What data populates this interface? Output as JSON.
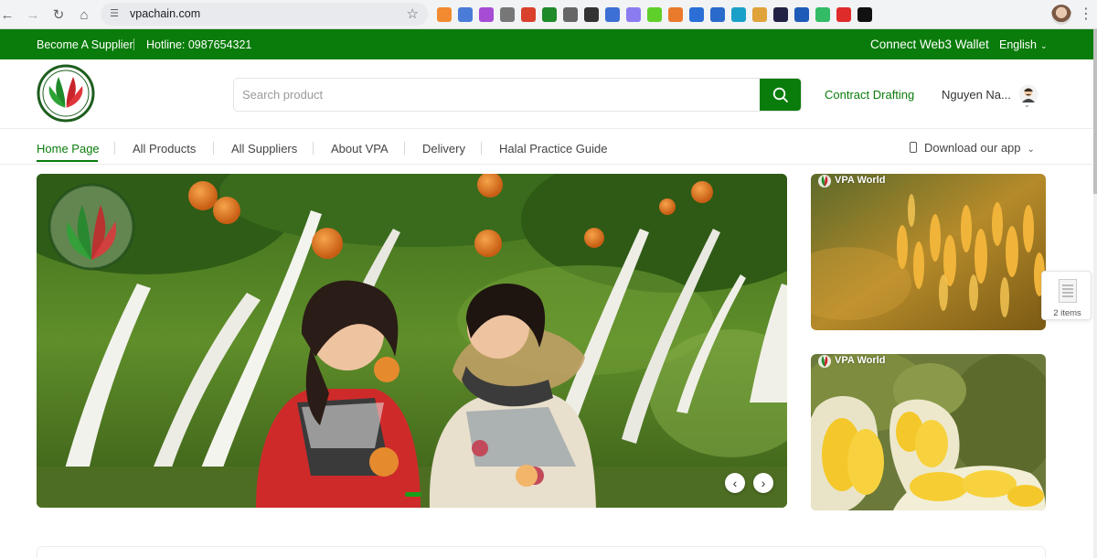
{
  "browser": {
    "url": "vpachain.com",
    "extension_colors": [
      "#f28b30",
      "#4a7bd8",
      "#a64bd4",
      "#777777",
      "#d9412c",
      "#1f8a2a",
      "#666666",
      "#333333",
      "#3d6fd4",
      "#8a7bf0",
      "#5fcf2a",
      "#e97a2b",
      "#2b6fd6",
      "#2a6acb",
      "#1aa0c8",
      "#e0a23a",
      "#222244",
      "#1e5bb8",
      "#33bb66",
      "#e02b2b",
      "#111111"
    ]
  },
  "topbar": {
    "become_supplier": "Become A Supplier",
    "hotline": "Hotline: 0987654321",
    "connect_wallet": "Connect Web3 Wallet",
    "language": "English",
    "bg_color": "#0a7c0b"
  },
  "header": {
    "search_placeholder": "Search product",
    "contract_drafting": "Contract Drafting",
    "username": "Nguyen Na..."
  },
  "nav": {
    "items": [
      "Home Page",
      "All Products",
      "All Suppliers",
      "About VPA",
      "Delivery",
      "Halal Practice Guide"
    ],
    "download_app": "Download our app"
  },
  "banners": {
    "side_tag_1": "VPA World",
    "side_tag_2": "VPA World"
  },
  "floating_cart": {
    "count_label": "2 items"
  }
}
